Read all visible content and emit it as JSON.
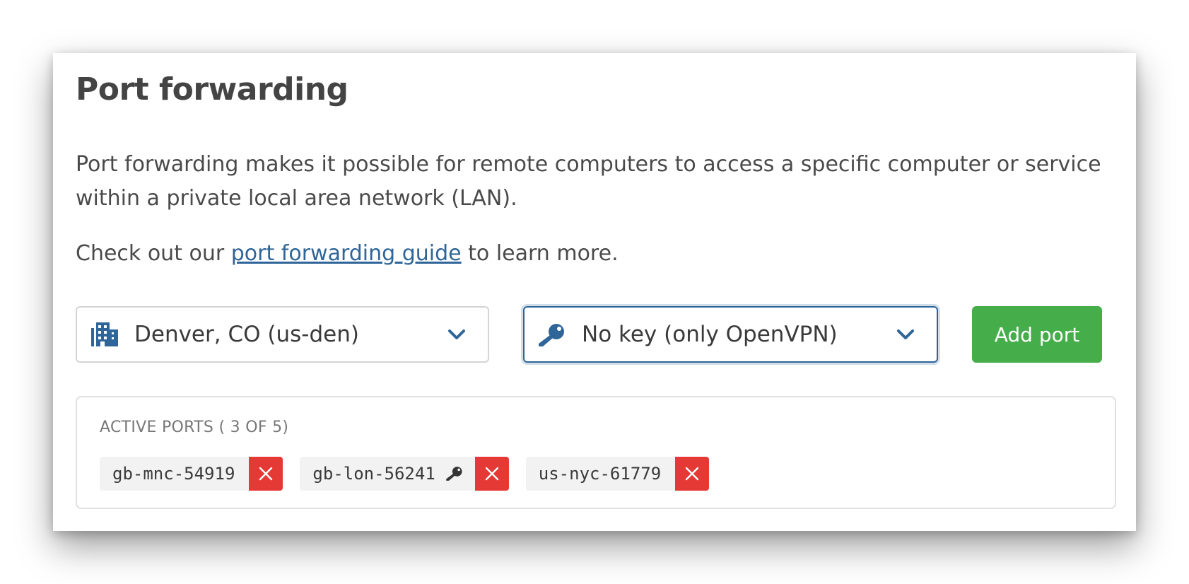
{
  "header": {
    "title": "Port forwarding"
  },
  "description": {
    "text": "Port forwarding makes it possible for remote computers to access a specific computer or service within a private local area network (LAN).",
    "guide_prefix": "Check out our",
    "guide_link": "port forwarding guide",
    "guide_suffix": "to learn more."
  },
  "controls": {
    "location": {
      "value": "Denver, CO (us-den)",
      "icon": "building-icon"
    },
    "key": {
      "value": "No key (only OpenVPN)",
      "icon": "key-icon",
      "focused": true
    },
    "add_label": "Add port"
  },
  "active_ports": {
    "label": "ACTIVE PORTS ( 3 OF 5)",
    "items": [
      {
        "name": "gb-mnc-54919",
        "has_key": false
      },
      {
        "name": "gb-lon-56241",
        "has_key": true
      },
      {
        "name": "us-nyc-61779",
        "has_key": false
      }
    ]
  },
  "colors": {
    "accent": "#2f6598",
    "add_button": "#45ae4a",
    "remove": "#e53935"
  }
}
